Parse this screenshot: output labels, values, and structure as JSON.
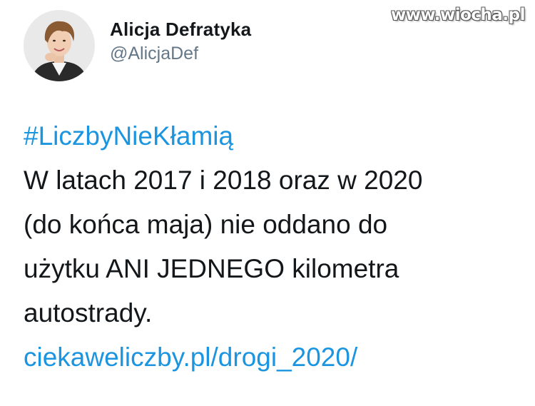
{
  "watermark": "www.wiocha.pl",
  "author": {
    "display_name": "Alicja Defratyka",
    "handle": "@AlicjaDef"
  },
  "tweet": {
    "hashtag": "#LiczbyNieKłamią",
    "lines": [
      "W latach 2017 i 2018 oraz w 2020",
      "(do końca maja) nie oddano do",
      "użytku ANI JEDNEGO kilometra",
      "autostrady."
    ],
    "link": "ciekaweliczby.pl/drogi_2020/"
  },
  "colors": {
    "link": "#1b95e0",
    "text": "#14171a",
    "secondary": "#657786"
  },
  "icons": {
    "avatar": "profile-photo"
  }
}
